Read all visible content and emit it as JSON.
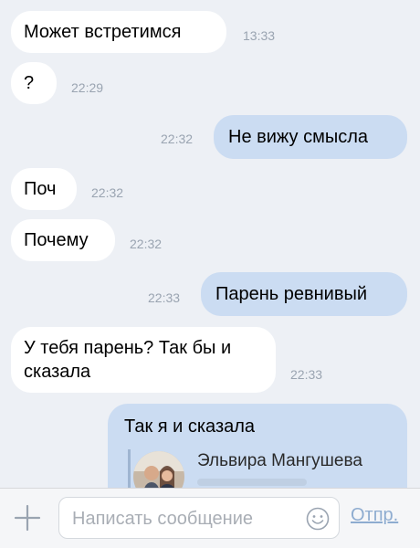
{
  "messages": [
    {
      "direction": "in",
      "text": "Может встретимся",
      "time": "13:33"
    },
    {
      "direction": "in",
      "text": "?",
      "time": "22:29"
    },
    {
      "direction": "out",
      "text": "Не вижу смысла",
      "time": "22:32"
    },
    {
      "direction": "in",
      "text": "Поч",
      "time": "22:32"
    },
    {
      "direction": "in",
      "text": "Почему",
      "time": "22:32"
    },
    {
      "direction": "out",
      "text": "Парень ревнивый",
      "time": "22:33"
    },
    {
      "direction": "in",
      "text": "У тебя парень? Так бы и сказала",
      "time": "22:33"
    },
    {
      "direction": "out",
      "text": "Так я и сказала"
    }
  ],
  "quoted": {
    "name": "Эльвира Мангушева"
  },
  "composer": {
    "placeholder": "Написать сообщение",
    "send_label": "Отпр."
  },
  "colors": {
    "background": "#edf0f5",
    "incoming": "#ffffff",
    "outgoing": "#cbdcf2",
    "accent": "#8eacd0"
  },
  "icons": {
    "attach": "plus-icon",
    "emoji": "smiley-icon",
    "quote_avatar": "user-photo"
  }
}
